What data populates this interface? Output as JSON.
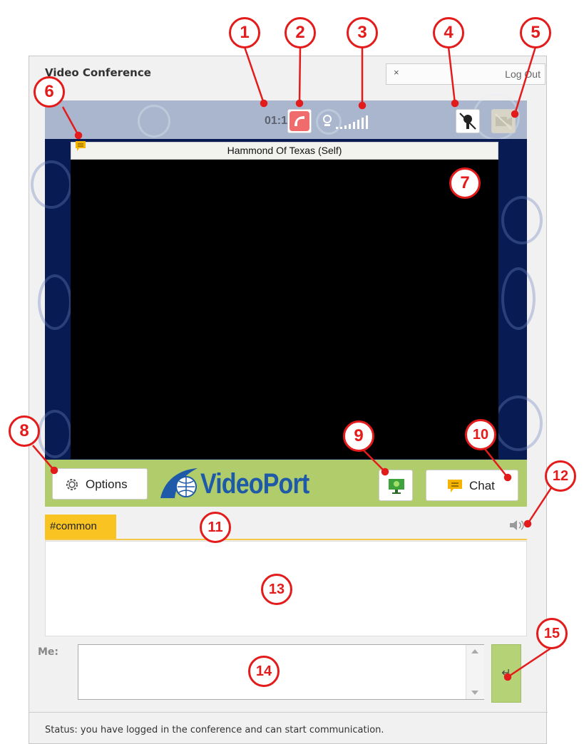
{
  "window": {
    "title": "Video Conference",
    "close_symbol": "×",
    "logout_label": "Log Out"
  },
  "call": {
    "timer": "01:13",
    "hangup_icon": "phone-hangup-icon",
    "signal_icon": "signal-strength-icon",
    "mic_icon": "microphone-muted-icon",
    "camera_icon": "camera-off-icon"
  },
  "video": {
    "participant_label": "Hammond Of Texas (Self)"
  },
  "toolbar": {
    "options_label": "Options",
    "logo_text": "VideoPort",
    "chat_label": "Chat",
    "screen_share_icon": "screen-share-icon"
  },
  "chat": {
    "channel_tab": "#common",
    "me_label": "Me:",
    "input_value": "",
    "send_icon": "↵",
    "sound_icon": "speaker-icon"
  },
  "status": {
    "text": "Status: you have logged in the conference and can start communication."
  },
  "callouts": [
    "1",
    "2",
    "3",
    "4",
    "5",
    "6",
    "7",
    "8",
    "9",
    "10",
    "11",
    "12",
    "13",
    "14",
    "15"
  ],
  "colors": {
    "callout_red": "#e31b1b",
    "topbar": "#a9b6cd",
    "video_bg": "#081c53",
    "toolbar_green": "#b1cd6b",
    "tab_yellow": "#f9c322",
    "logo_blue": "#1e5aa8"
  }
}
